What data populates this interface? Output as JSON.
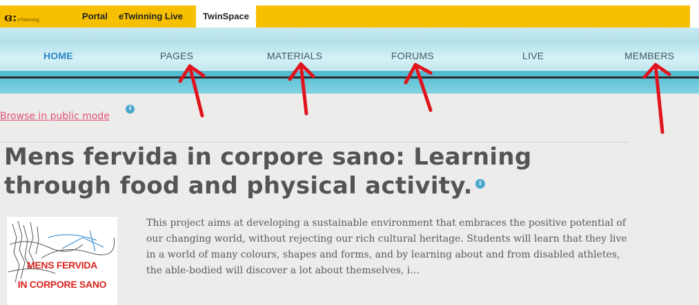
{
  "topbar": {
    "logo_text": "eTwinning",
    "tabs": [
      {
        "label": "Portal"
      },
      {
        "label": "eTwinning Live"
      },
      {
        "label": "TwinSpace"
      }
    ]
  },
  "nav": {
    "items": [
      {
        "label": "HOME"
      },
      {
        "label": "PAGES"
      },
      {
        "label": "MATERIALS"
      },
      {
        "label": "FORUMS"
      },
      {
        "label": "LIVE"
      },
      {
        "label": "MEMBERS"
      }
    ]
  },
  "content": {
    "browse_link": "Browse in public mode",
    "title": "Mens fervida in corpore sano: Learning through food and physical activity.",
    "description": "This project aims at developing a sustainable environment that embraces the positive potential of our changing world, without rejecting our rich cultural heritage. Students will learn that they live in a world of many colours, shapes and forms, and by learning about and from disabled athletes, the able-bodied will discover a lot about themselves, i...",
    "thumbnail": {
      "line1": "MENS FERVIDA",
      "line2": "IN CORPORE SANO"
    }
  },
  "colors": {
    "accent_yellow": "#f6c000",
    "nav_blue": "#b6e3ec",
    "active_nav": "#2a85c6",
    "link_pink": "#e0507a",
    "annotation_red": "#e0141e"
  },
  "icons": {
    "info": "info-icon",
    "annotation_arrow": "red-arrow-icon"
  }
}
